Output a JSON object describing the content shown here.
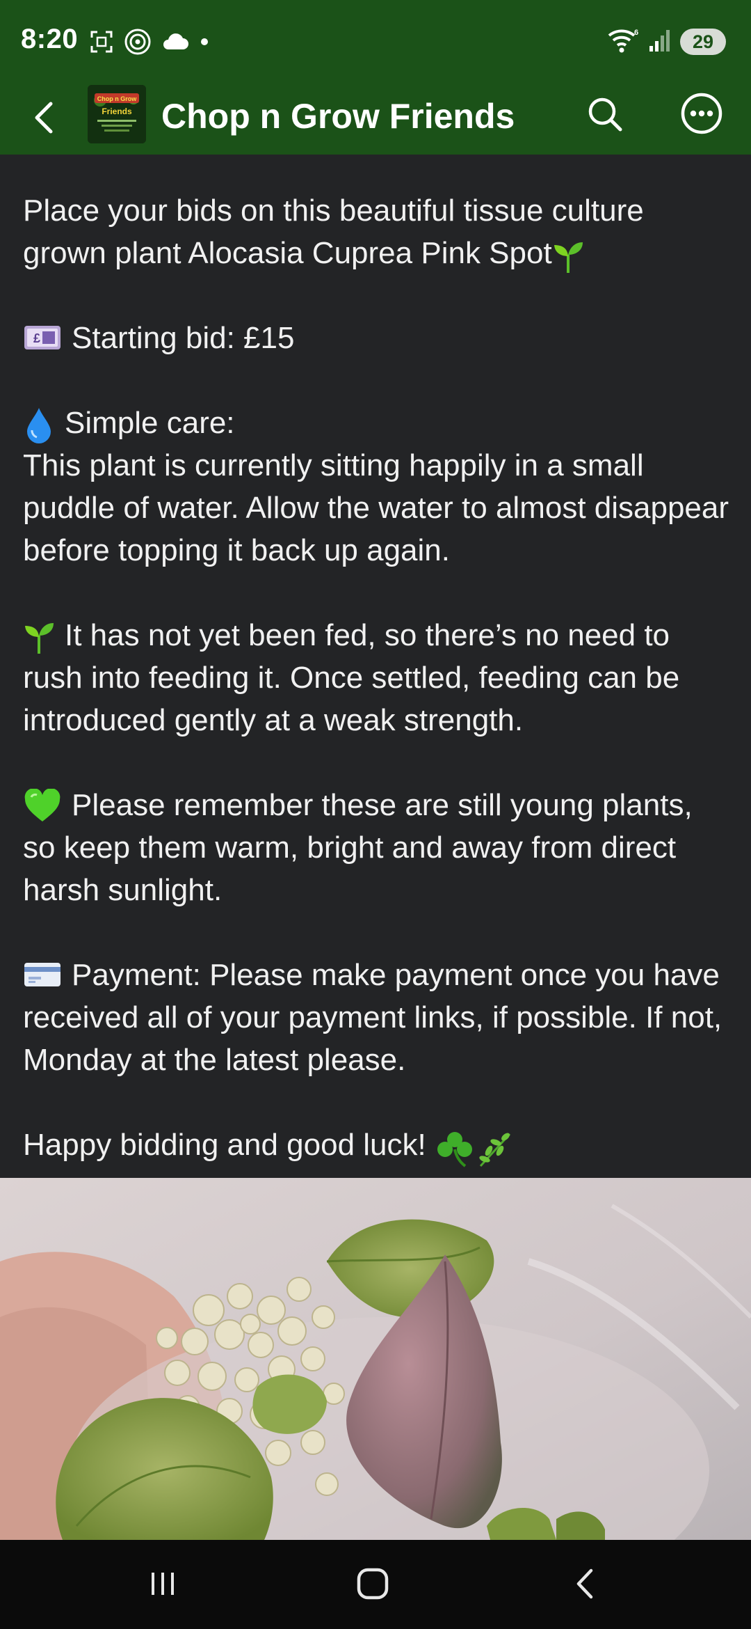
{
  "status_bar": {
    "time": "8:20",
    "battery": "29",
    "icons": [
      "screenshot-icon",
      "hotspot-icon",
      "cloud-icon",
      "dot-icon",
      "wifi-icon",
      "signal-icon",
      "battery-icon"
    ]
  },
  "app_bar": {
    "title": "Chop n Grow Friends",
    "icons": [
      "back-arrow-icon",
      "search-icon",
      "more-options-icon"
    ],
    "logo_text": "Chop n Grow Friends"
  },
  "post": {
    "p1_line1": "Place your bids on this beautiful tissue culture",
    "p1_line2": "grown plant Alocasia Cuprea Pink Spot",
    "starting_bid": "Starting bid: £15",
    "care_heading": "Simple care:",
    "care_text": "This plant is currently sitting happily in a small puddle of water. Allow the water to almost disappear before topping it back up again.",
    "feeding_text": "It has not yet been fed, so there’s no need to rush into feeding it. Once settled, feeding can be introduced gently at a weak strength.",
    "young_text": "Please remember these are still young plants, so keep them warm, bright and away from direct harsh sunlight.",
    "payment_text": "Payment: Please make payment once you have received all of your payment links, if possible. If not, Monday at the latest please.",
    "closing": "Happy bidding and good luck!",
    "emojis": [
      "seedling",
      "pound-banknote",
      "droplet",
      "seedling",
      "green-heart",
      "credit-card",
      "shamrock",
      "herb"
    ]
  },
  "photo": {
    "subject": "alocasia-plant-photo"
  },
  "nav_bar": {
    "icons": [
      "recent-apps-icon",
      "home-icon",
      "back-nav-icon"
    ]
  },
  "colors": {
    "header_green": "#1b5218",
    "background": "#232426",
    "text": "#f1f1f1"
  }
}
